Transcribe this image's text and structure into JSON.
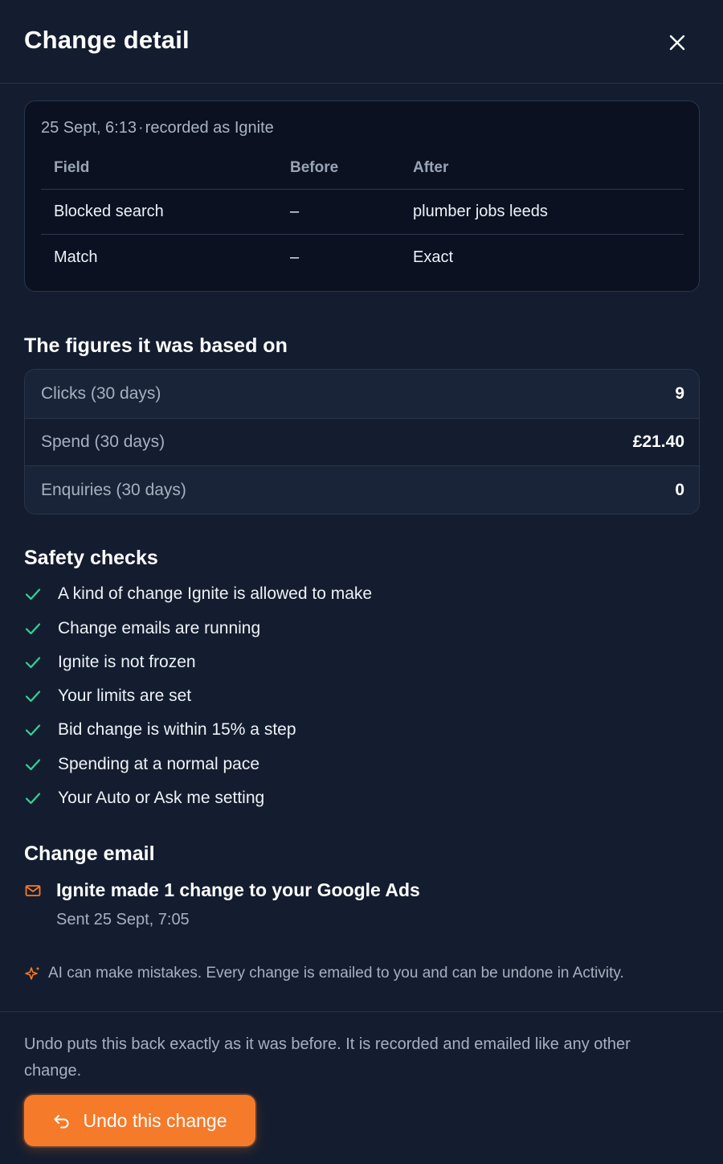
{
  "header": {
    "title": "Change detail",
    "close_icon": "close-icon"
  },
  "record": {
    "timestamp": "25 Sept, 6:13",
    "separator": "·",
    "recorded_as": "recorded as Ignite",
    "columns": [
      "Field",
      "Before",
      "After"
    ],
    "rows": [
      {
        "field": "Blocked search",
        "before": "–",
        "after": "plumber jobs leeds"
      },
      {
        "field": "Match",
        "before": "–",
        "after": "Exact"
      }
    ]
  },
  "figures": {
    "title": "The figures it was based on",
    "items": [
      {
        "label": "Clicks (30 days)",
        "value": "9"
      },
      {
        "label": "Spend (30 days)",
        "value": "£21.40"
      },
      {
        "label": "Enquiries (30 days)",
        "value": "0"
      }
    ]
  },
  "safety": {
    "title": "Safety checks",
    "items": [
      "A kind of change Ignite is allowed to make",
      "Change emails are running",
      "Ignite is not frozen",
      "Your limits are set",
      "Bid change is within 15% a step",
      "Spending at a normal pace",
      "Your Auto or Ask me setting"
    ]
  },
  "email": {
    "title": "Change email",
    "subject": "Ignite made 1 change to your Google Ads",
    "sent": "Sent 25 Sept, 7:05"
  },
  "ai_note": "AI can make mistakes. Every change is emailed to you and can be undone in Activity.",
  "footer": {
    "text": "Undo puts this back exactly as it was before. It is recorded and emailed like any other change.",
    "undo_label": "Undo this change"
  },
  "colors": {
    "background": "#141d2f",
    "card": "#0b1121",
    "accent": "#f57a2a",
    "check": "#34d399",
    "email_icon": "#f57a2a"
  }
}
